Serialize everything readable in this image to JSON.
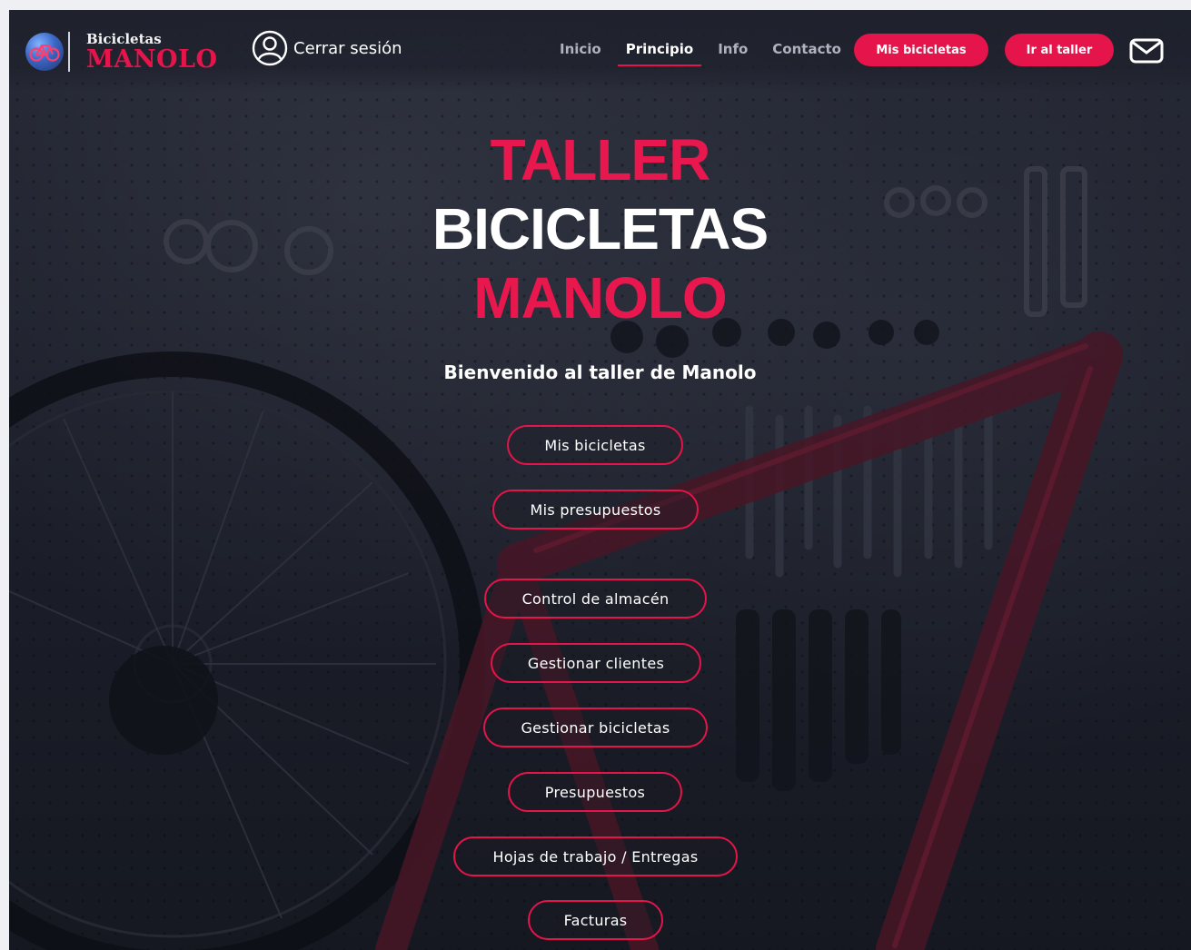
{
  "brand": {
    "small": "Bicicletas",
    "big": "MANOLO"
  },
  "header": {
    "logout_label": "Cerrar sesión",
    "nav": [
      {
        "label": "Inicio",
        "active": false
      },
      {
        "label": "Principio",
        "active": true
      },
      {
        "label": "Info",
        "active": false
      },
      {
        "label": "Contacto",
        "active": false
      }
    ],
    "buttons": {
      "my_bikes": "Mis bicicletas",
      "workshop": "Ir al taller"
    },
    "icons": [
      "bike-logo-icon",
      "user-circle-icon",
      "mail-icon"
    ]
  },
  "hero": {
    "line1": "TALLER",
    "line2": "BICICLETAS",
    "line3": "MANOLO",
    "subtitle": "Bienvenido al taller de Manolo"
  },
  "actions": [
    "Mis bicicletas",
    "Mis presupuestos",
    "Control de almacén",
    "Gestionar clientes",
    "Gestionar bicicletas",
    "Presupuestos",
    "Hojas de trabajo / Entregas",
    "Facturas"
  ],
  "colors": {
    "accent": "#e5144a",
    "background": "#1e212c",
    "text": "#ffffff"
  }
}
